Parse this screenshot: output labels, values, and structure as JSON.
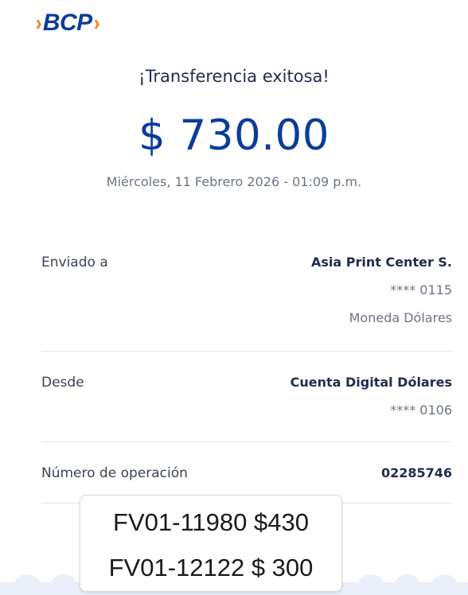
{
  "brand": {
    "name": "BCP",
    "chevron_left": "›",
    "chevron_right": "›",
    "colors": {
      "primary": "#0a3c9c",
      "accent": "#ff7800"
    }
  },
  "receipt": {
    "title": "¡Transferencia exitosa!",
    "amount": "$ 730.00",
    "datetime": "Miércoles, 11 Febrero 2026 - 01:09 p.m."
  },
  "details": {
    "sent_to": {
      "label": "Enviado a",
      "name": "Asia Print Center S.",
      "account": "**** 0115",
      "currency": "Moneda Dólares"
    },
    "from": {
      "label": "Desde",
      "account_name": "Cuenta Digital Dólares",
      "account": "**** 0106"
    },
    "operation": {
      "label": "Número de operación",
      "number": "02285746"
    }
  },
  "note": {
    "line1": "FV01-11980 $430",
    "line2": "FV01-12122 $ 300"
  }
}
